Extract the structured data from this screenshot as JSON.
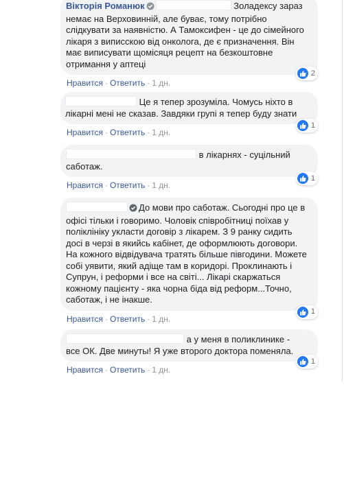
{
  "actions": {
    "like": "Нравится",
    "reply": "Ответить",
    "sep": "·"
  },
  "comments": [
    {
      "author": "Вікторія Романюк",
      "text": "Золадексу зараз немає на Верховинній, але буває, тому потрібно слідкувати за наявністю. А Тамоксифен - це до сімейного лікаря з виписскою від онколога, де є призначення. Він має виписувати щомісяця рецепт на безкоштовне отримання у аптеці",
      "time": "1 дн.",
      "reactions": "2"
    },
    {
      "text": "Це я тепер зрозуміла. Чомусь ніхто в лікарні мені не сказав. Завдяки групі я тепер буду знати",
      "time": "1 дн.",
      "reactions": "1"
    },
    {
      "text": "в лікарнях - суцільний саботаж.",
      "time": "1 дн.",
      "reactions": "1"
    },
    {
      "text": "До мови про саботаж. Сьогодні про це в офісі тільки і говоримо. Чоловік співробітниці поїхав у поліклініку укласти договір з лікарем. З 9 ранку сидить досі в черзі в якийсь кабінет, де оформлюють договори. На кожного відвідувача тратять більше півгодини. Можете собі уявити, який адіще там в коридорі. Проклинають і Супрун, і реформи і все на світі... Лікарі скаржаться кожному пацієнту - яка чорна біда від реформ...Точно, саботаж, і не інакше.",
      "time": "1 дн.",
      "reactions": "1"
    },
    {
      "text": "а у меня в поликлинике - все ОК. Две минуты! Я уже второго доктора поменяла.",
      "time": "1 дн.",
      "reactions": "1"
    }
  ]
}
